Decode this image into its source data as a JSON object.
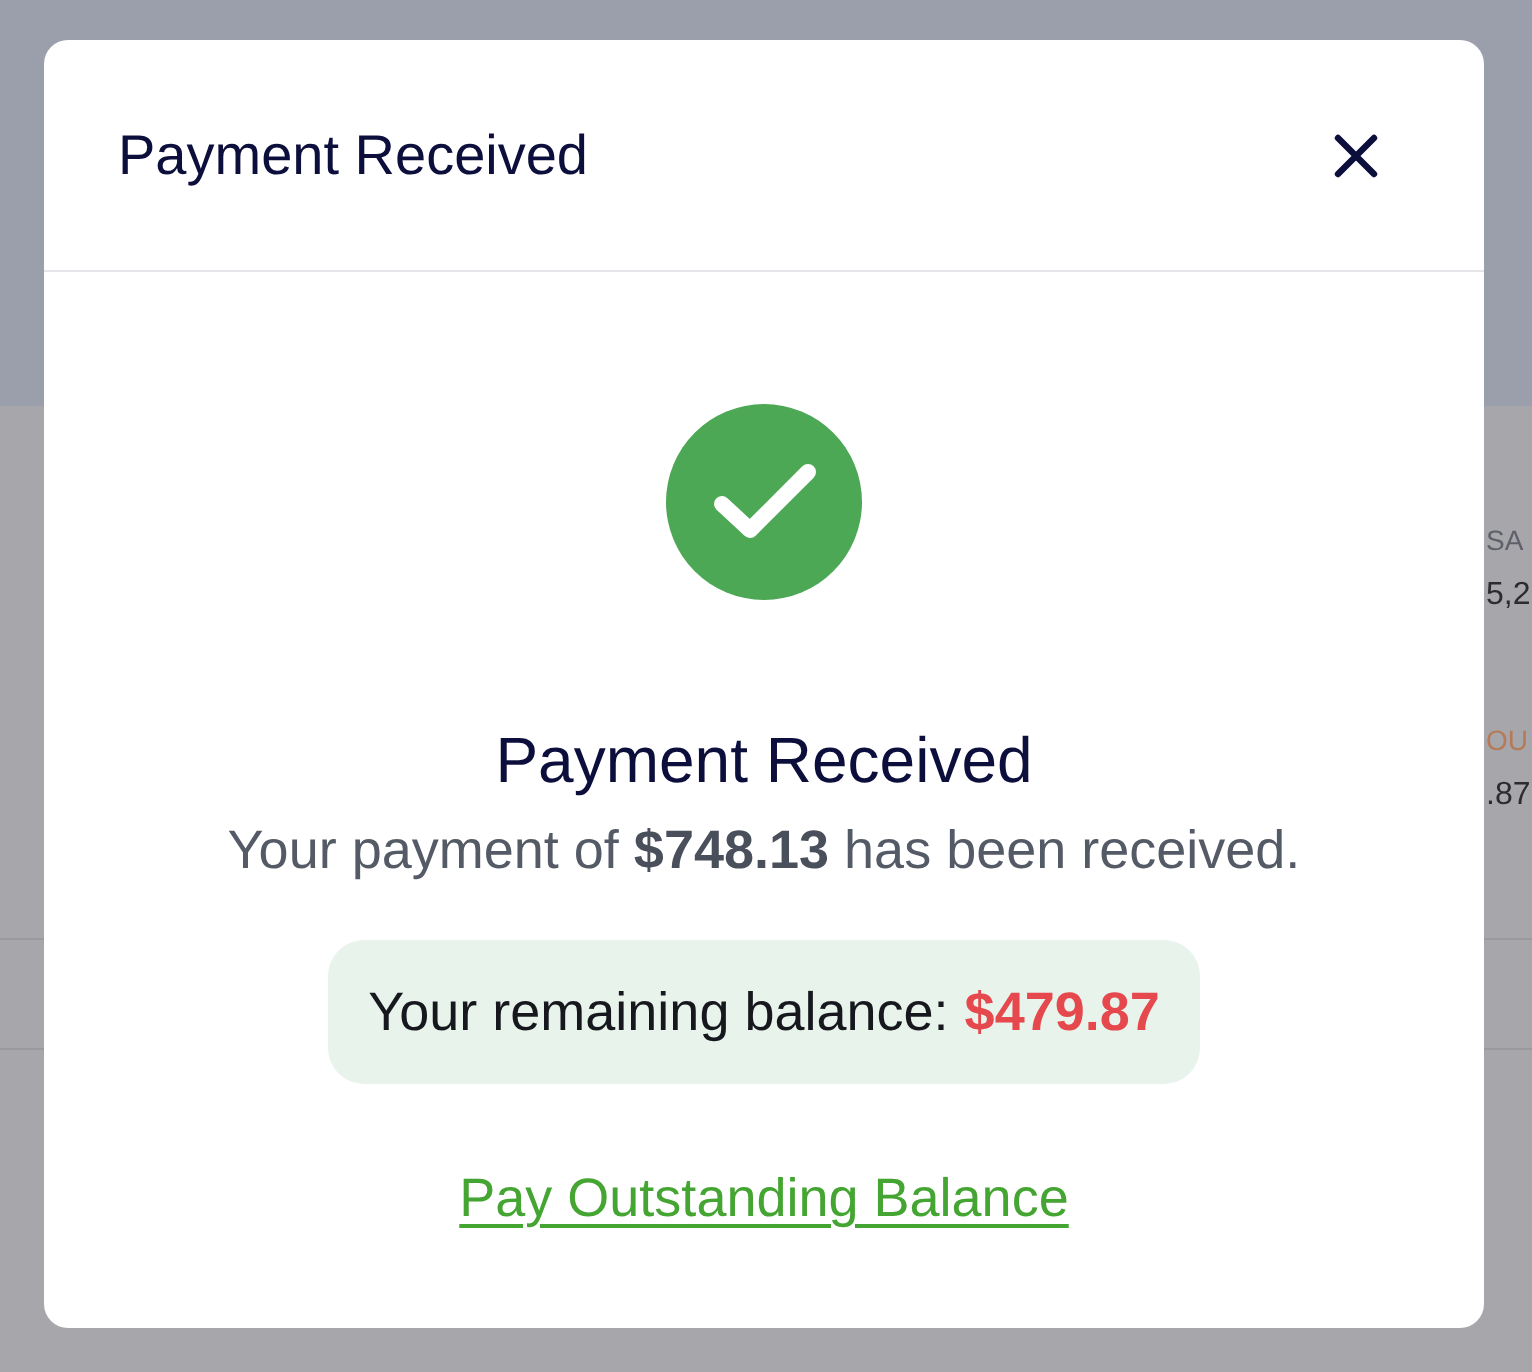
{
  "background_page": {
    "stats": [
      {
        "label": "SA",
        "value": "5,2",
        "color": "#5e6169"
      },
      {
        "label": "OU",
        "value": ".87",
        "color": "#b57a58"
      }
    ]
  },
  "modal": {
    "title": "Payment Received",
    "heading": "Payment Received",
    "message": "Your payment of **$748.13** has been received.",
    "balance": {
      "label": "Your remaining balance:",
      "amount": "$479.87"
    },
    "link": "Pay Outstanding Balance"
  }
}
